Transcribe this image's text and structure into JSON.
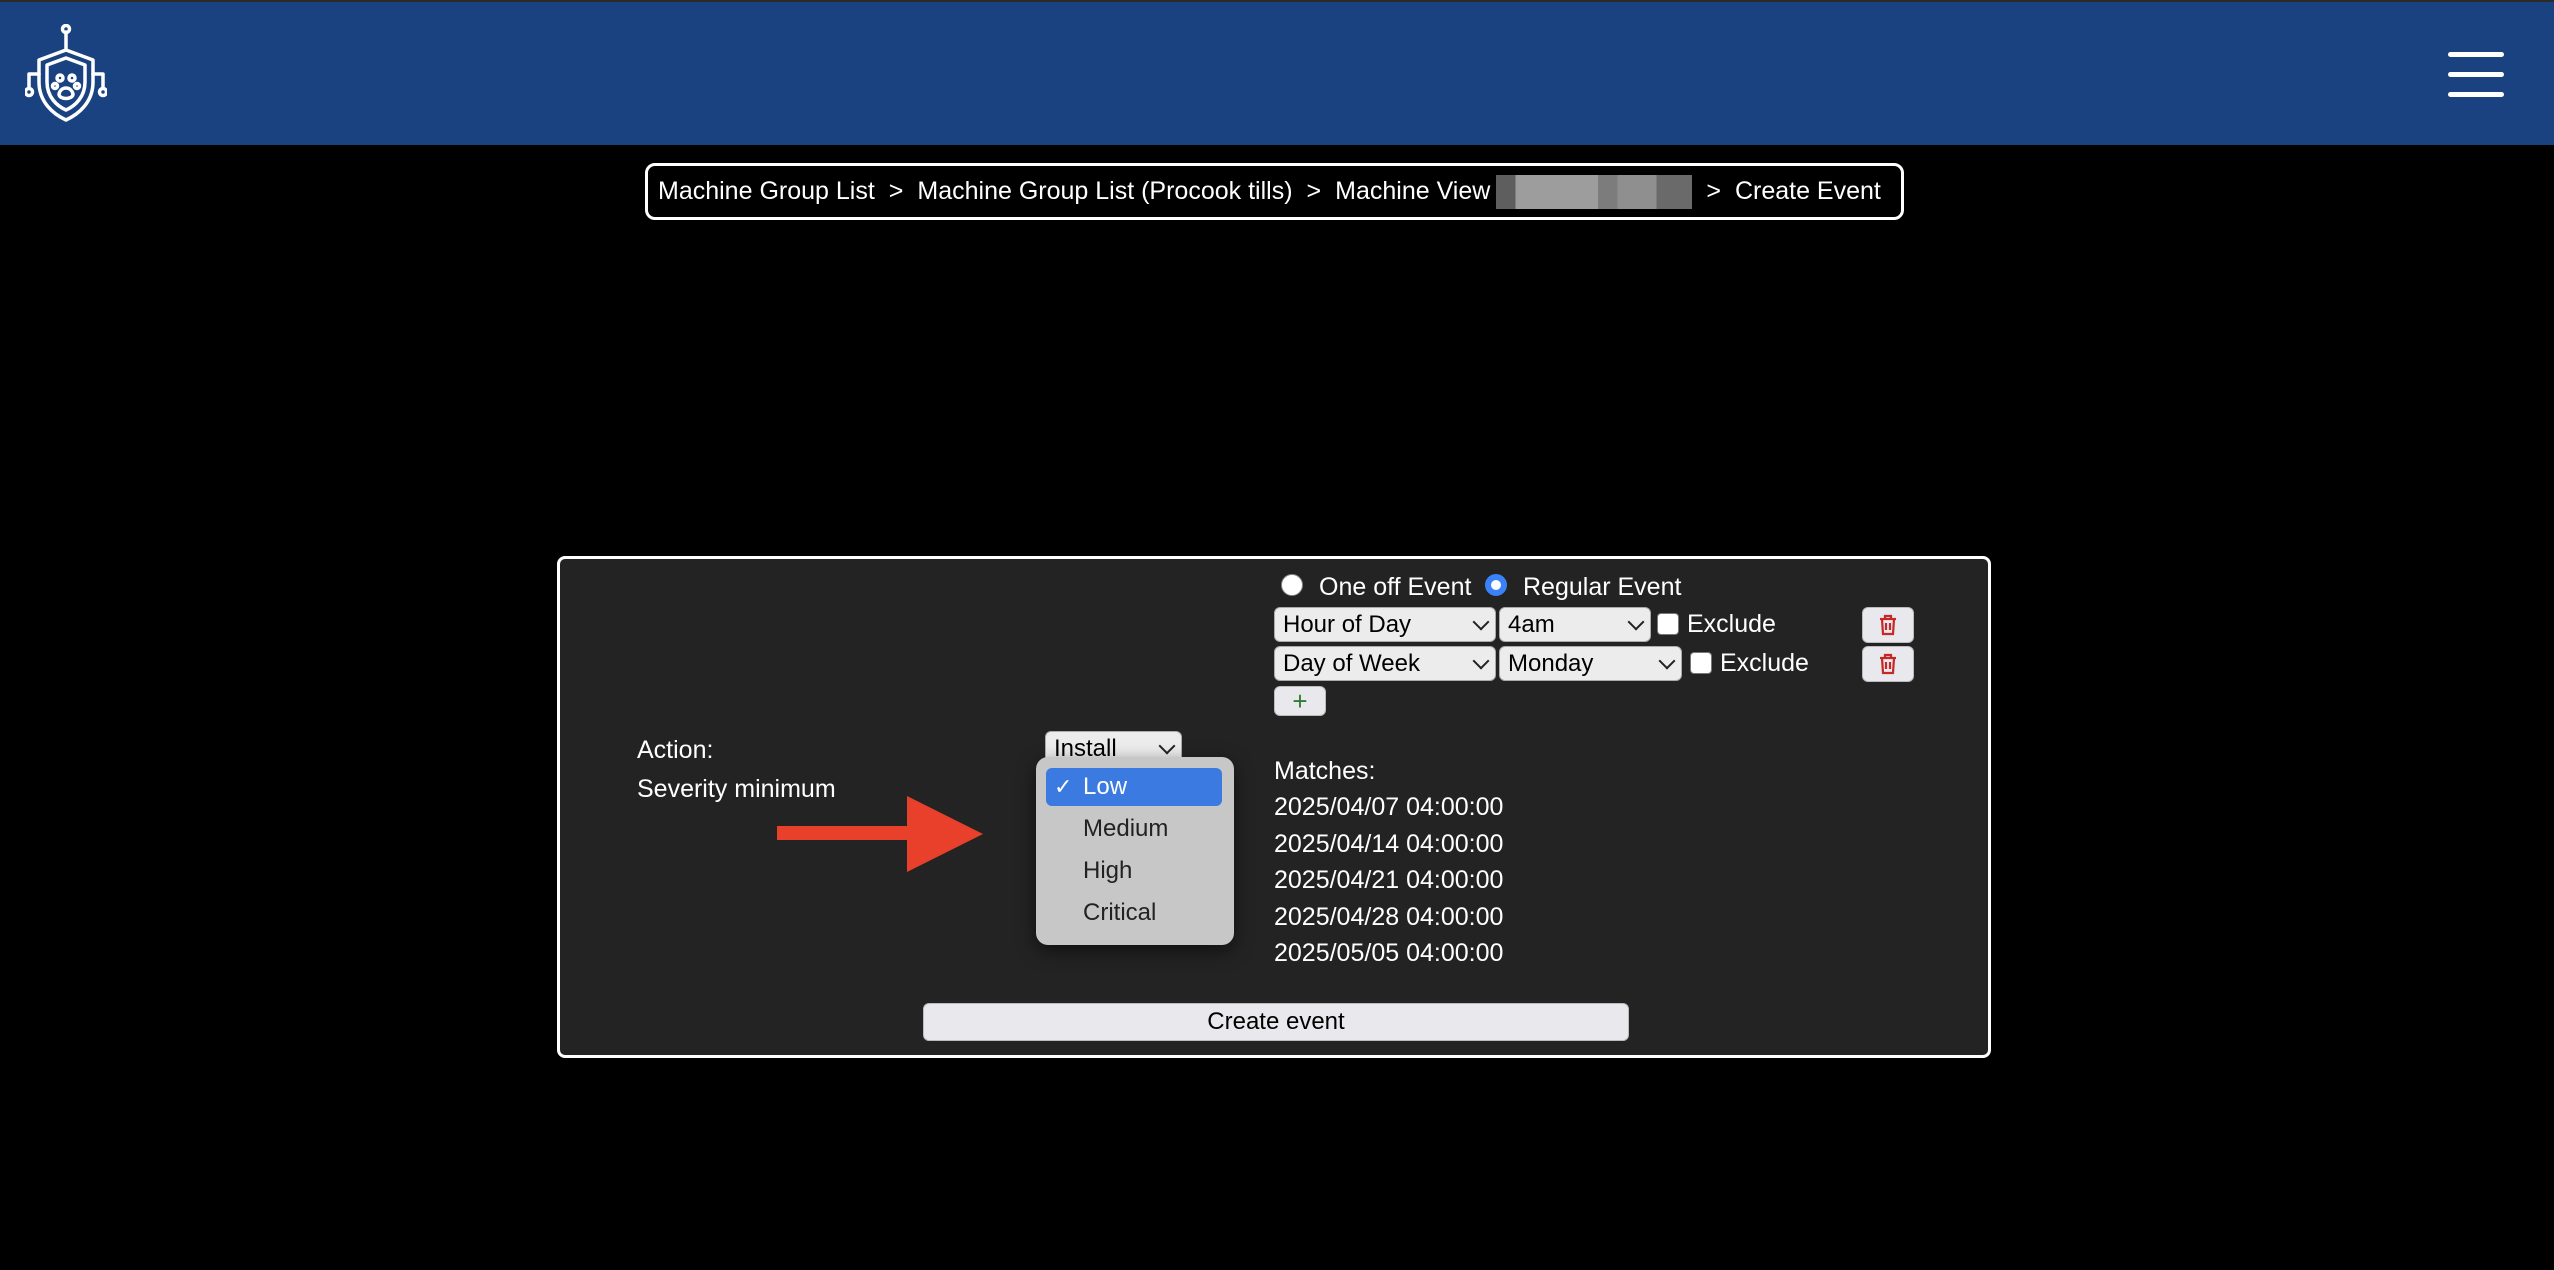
{
  "colors": {
    "header": "#1a4281",
    "panel": "#232323",
    "accent": "#3b7ae0",
    "arrow": "#e8402a"
  },
  "header": {
    "logo_icon": "shield-paw-logo-icon",
    "menu_icon": "hamburger-menu-icon"
  },
  "breadcrumb": {
    "items": [
      "Machine Group List",
      "Machine Group List (Procook tills)",
      "Machine View",
      "Create Event"
    ],
    "separator": ">"
  },
  "event_type": {
    "one_off_label": "One off Event",
    "regular_label": "Regular Event",
    "selected": "Regular Event"
  },
  "rules": [
    {
      "type": "Hour of Day",
      "value": "4am",
      "exclude_label": "Exclude",
      "exclude_checked": false
    },
    {
      "type": "Day of Week",
      "value": "Monday",
      "exclude_label": "Exclude",
      "exclude_checked": false
    }
  ],
  "add_rule_label": "+",
  "form": {
    "action_label": "Action:",
    "action_value": "Install",
    "severity_label": "Severity minimum"
  },
  "severity_options": {
    "items": [
      "Low",
      "Medium",
      "High",
      "Critical"
    ],
    "selected": "Low",
    "check_glyph": "✓"
  },
  "matches": {
    "label": "Matches:",
    "items": [
      "2025/04/07 04:00:00",
      "2025/04/14 04:00:00",
      "2025/04/21 04:00:00",
      "2025/04/28 04:00:00",
      "2025/05/05 04:00:00"
    ]
  },
  "create_button_label": "Create event"
}
